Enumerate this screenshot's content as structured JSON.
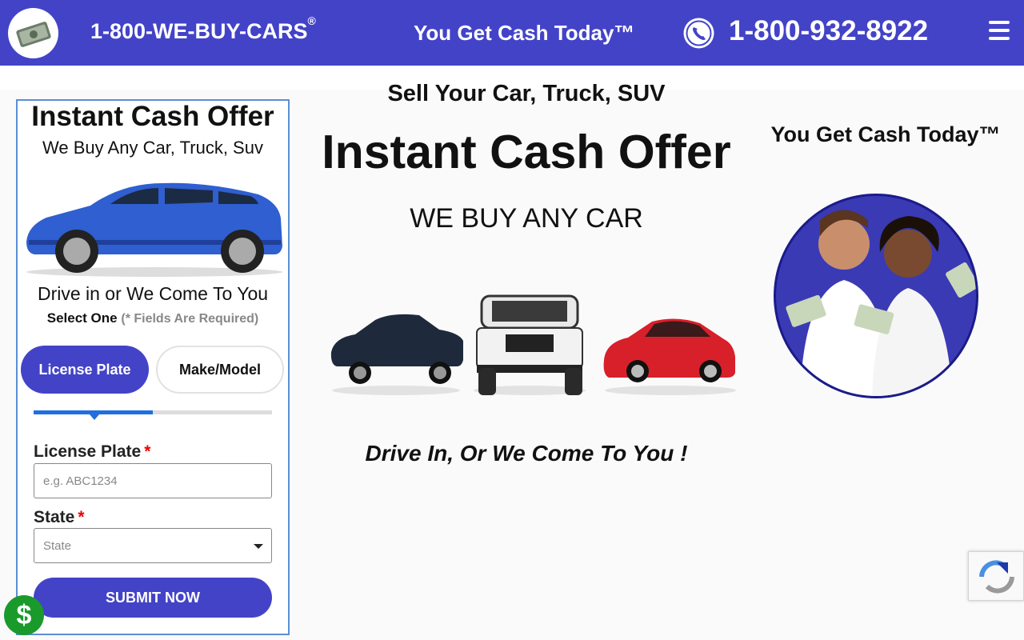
{
  "header": {
    "brand": "1-800-WE-BUY-CARS",
    "brand_mark": "®",
    "tagline": "You Get Cash Today™",
    "phone": "1-800-932-8922"
  },
  "form": {
    "title": "Instant Cash Offer",
    "subtitle": "We Buy Any Car, Truck, Suv",
    "drive_text": "Drive in or We Come To You",
    "select_label": "Select One",
    "required_note": "(* Fields Are Required)",
    "tabs": [
      {
        "label": "License Plate",
        "active": true
      },
      {
        "label": "Make/Model",
        "active": false
      }
    ],
    "progress_fraction": 0.5,
    "plate_label": "License Plate",
    "plate_placeholder": "e.g. ABC1234",
    "state_label": "State",
    "state_placeholder": "State",
    "required_star": "*",
    "submit_label": "SUBMIT NOW"
  },
  "center": {
    "sell_line": "Sell Your Car, Truck, SUV",
    "offer_line": "Instant Cash Offer",
    "any_car_line": "WE BUY ANY CAR",
    "drive_line": "Drive In, Or We Come To You !"
  },
  "right": {
    "cash_line": "You Get Cash Today™"
  },
  "floating": {
    "dollar_symbol": "$"
  },
  "colors": {
    "brand_blue": "#4343c8",
    "progress_blue": "#1f6fe0",
    "required_red": "#ee0000",
    "dollar_green": "#1b9a2c"
  },
  "icons": [
    "money-logo-icon",
    "phone-icon",
    "hamburger-menu-icon",
    "dollar-icon",
    "recaptcha-icon"
  ]
}
